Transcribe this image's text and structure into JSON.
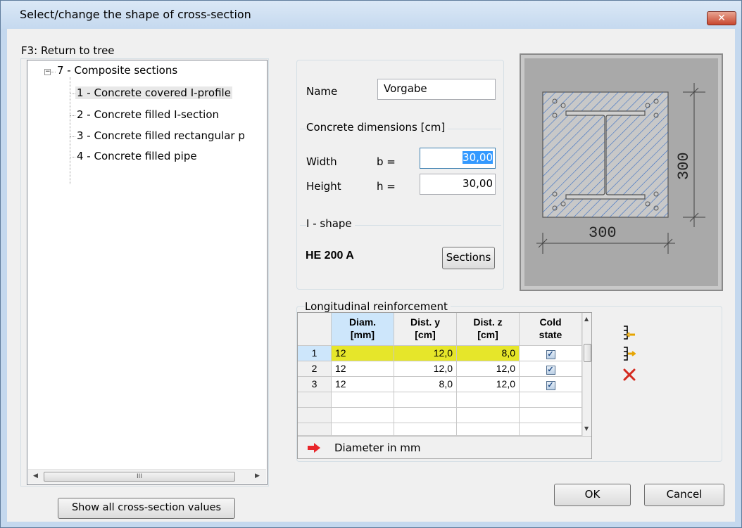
{
  "window": {
    "title": "Select/change the shape of cross-section",
    "close_glyph": "✕"
  },
  "tree": {
    "group_label": "F3: Return to tree",
    "root": "7 - Composite sections",
    "items": [
      "1 - Concrete covered I-profile",
      "2 - Concrete filled I-section",
      "3 - Concrete filled rectangular p",
      "4 - Concrete filled pipe"
    ],
    "scroll_thumb_glyph": "III"
  },
  "show_values_button": "Show all cross-section values",
  "props": {
    "name_label": "Name",
    "name_value": "Vorgabe",
    "concrete_group": "Concrete dimensions [cm]",
    "width_label": "Width",
    "width_symbol": "b  =",
    "width_value": "30,00",
    "height_label": "Height",
    "height_symbol": "h  =",
    "height_value": "30,00",
    "ishape_group": "I - shape",
    "ishape_value": "HE  200 A",
    "sections_button": "Sections"
  },
  "preview": {
    "dim_bottom": "300",
    "dim_right": "300"
  },
  "reinforcement": {
    "group_label": "Longitudinal reinforcement",
    "columns": [
      [
        "Diam.",
        "[mm]"
      ],
      [
        "Dist. y",
        "[cm]"
      ],
      [
        "Dist. z",
        "[cm]"
      ],
      [
        "Cold",
        "state"
      ]
    ],
    "rows": [
      {
        "index": "1",
        "diam": "12",
        "dist_y": "12,0",
        "dist_z": "8,0",
        "cold": true
      },
      {
        "index": "2",
        "diam": "12",
        "dist_y": "12,0",
        "dist_z": "12,0",
        "cold": true
      },
      {
        "index": "3",
        "diam": "12",
        "dist_y": "8,0",
        "dist_z": "12,0",
        "cold": true
      }
    ],
    "check_glyph": "✓",
    "status_text": "Diameter in mm",
    "colors": {
      "highlight_row": "#e6e62a",
      "status_arrow": "#e8262a",
      "delete_icon": "#d42a1f"
    }
  },
  "buttons": {
    "ok": "OK",
    "cancel": "Cancel"
  }
}
